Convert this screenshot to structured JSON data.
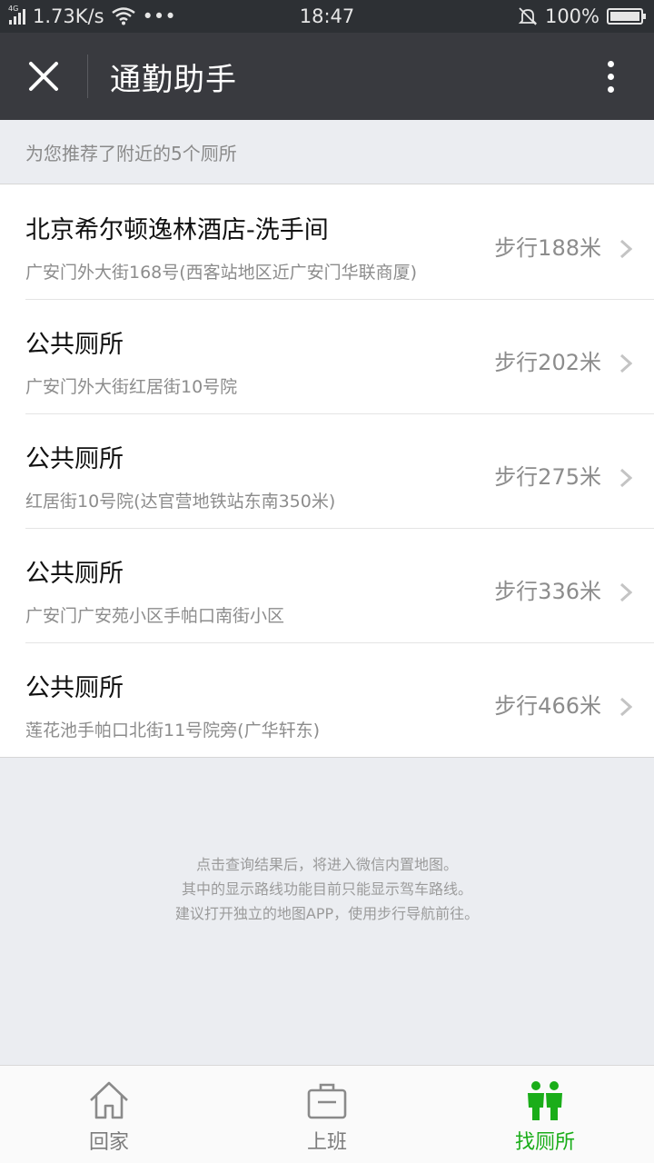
{
  "status_bar": {
    "network_type": "4G",
    "speed": "1.73K/s",
    "more": "•••",
    "time": "18:47",
    "battery": "100%"
  },
  "title_bar": {
    "title": "通勤助手"
  },
  "recommend_text": "为您推荐了附近的5个厕所",
  "toilets": [
    {
      "name": "北京希尔顿逸林酒店-洗手间",
      "address": "广安门外大街168号(西客站地区近广安门华联商厦)",
      "distance": "步行188米"
    },
    {
      "name": "公共厕所",
      "address": "广安门外大街红居街10号院",
      "distance": "步行202米"
    },
    {
      "name": "公共厕所",
      "address": "红居街10号院(达官营地铁站东南350米)",
      "distance": "步行275米"
    },
    {
      "name": "公共厕所",
      "address": "广安门广安苑小区手帕口南街小区",
      "distance": "步行336米"
    },
    {
      "name": "公共厕所",
      "address": "莲花池手帕口北街11号院旁(广华轩东)",
      "distance": "步行466米"
    }
  ],
  "notice": {
    "line1": "点击查询结果后，将进入微信内置地图。",
    "line2": "其中的显示路线功能目前只能显示驾车路线。",
    "line3": "建议打开独立的地图APP，使用步行导航前往。"
  },
  "tabs": [
    {
      "label": "回家",
      "icon": "home-icon",
      "active": false
    },
    {
      "label": "上班",
      "icon": "briefcase-icon",
      "active": false
    },
    {
      "label": "找厕所",
      "icon": "restroom-icon",
      "active": true
    }
  ],
  "colors": {
    "active_tab": "#1aad19",
    "title_bar": "#393a3f",
    "status_bar": "#2d3034"
  }
}
